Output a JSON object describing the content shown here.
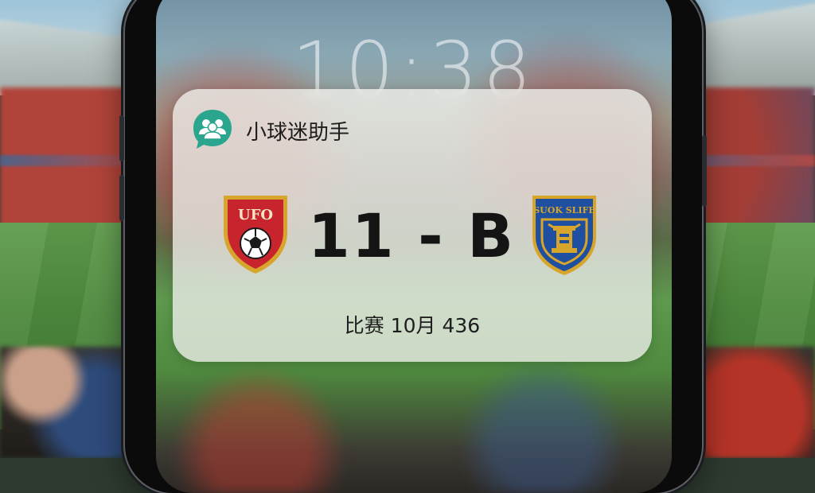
{
  "lock_screen": {
    "time": "10:38"
  },
  "notification": {
    "app_name": "小球迷助手",
    "app_icon": "group-chat-icon",
    "home_team": {
      "crest_text": "UFO",
      "crest_icon": "soccer-ball-icon",
      "crest_color": "#c8242d"
    },
    "away_team": {
      "crest_text": "SUOK SLIFE",
      "crest_icon": "trophy-pedestal-icon",
      "crest_color": "#1f4fa0"
    },
    "score": "11 - B",
    "match_info": "比赛 10月 436"
  },
  "colors": {
    "app_icon_bg": "#2aa68e",
    "crest_gold": "#d7a52b",
    "widget_bg": "#eef0ec"
  }
}
